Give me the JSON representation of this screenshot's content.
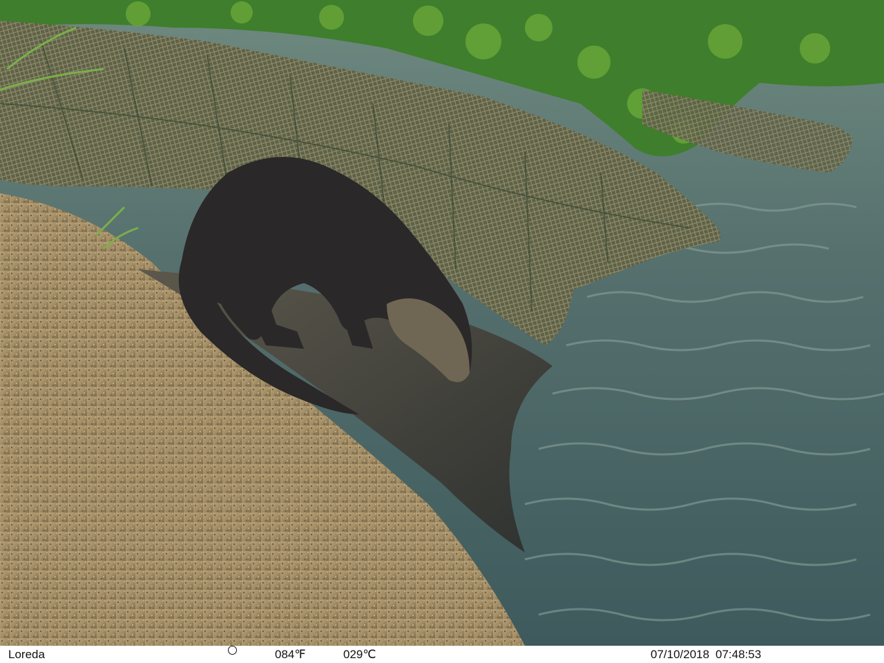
{
  "camera_info": {
    "location": "Loreda",
    "moon_phase_icon": "full-moon-icon",
    "temp_f": "084℉",
    "temp_c": "029℃",
    "date": "07/10/2018",
    "time": "07:48:53"
  },
  "scene": {
    "subject": "otter",
    "colors": {
      "water": "#4f6e70",
      "rock": "#a48f66",
      "foliage": "#3f7e2c",
      "net": "#7b7a5c",
      "otter": "#2a2828",
      "infobar": "#ffffff"
    }
  }
}
